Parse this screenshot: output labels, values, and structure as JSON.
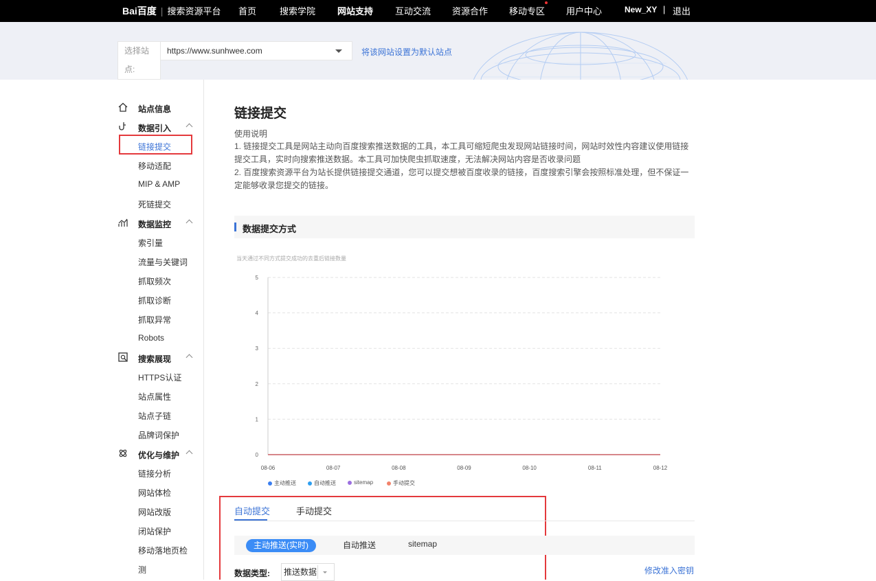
{
  "topnav": {
    "logo_text": "Bai百度",
    "platform": "搜索资源平台",
    "items": [
      "首页",
      "搜索学院",
      "网站支持",
      "互动交流",
      "资源合作",
      "移动专区",
      "用户中心"
    ],
    "active_item": "网站支持",
    "username": "New_XY",
    "separator": "|",
    "logout": "退出"
  },
  "site_selector": {
    "label": "选择站点:",
    "label_line1": "选择站",
    "label_line2": "点:",
    "value": "https://www.sunhwee.com",
    "set_default": "将该网站设置为默认站点"
  },
  "sidebar": {
    "sections": [
      {
        "label": "站点信息",
        "icon": "home-icon",
        "items": []
      },
      {
        "label": "数据引入",
        "icon": "data-import-icon",
        "items": [
          "链接提交",
          "移动适配",
          "MIP & AMP",
          "死链提交"
        ]
      },
      {
        "label": "数据监控",
        "icon": "monitor-icon",
        "items": [
          "索引量",
          "流量与关键词",
          "抓取频次",
          "抓取诊断",
          "抓取异常",
          "Robots"
        ]
      },
      {
        "label": "搜索展现",
        "icon": "search-display-icon",
        "items": [
          "HTTPS认证",
          "站点属性",
          "站点子链",
          "品牌词保护"
        ]
      },
      {
        "label": "优化与维护",
        "icon": "optimize-icon",
        "items": [
          "链接分析",
          "网站体检",
          "网站改版",
          "闭站保护",
          "移动落地页检",
          "测"
        ]
      }
    ],
    "active_item": "链接提交"
  },
  "main": {
    "title": "链接提交",
    "usage_title": "使用说明",
    "usage_paragraphs": [
      [
        "1. 链接提交工具是网站主动向百度搜索推送数据的工具，本工具可缩短爬虫发现网站链接时间，网站时效性内容建议使用链接",
        "提交工具，实时向搜索推送数据。本工具可加快爬虫抓取速度，无法解决网站内容是否收录问题"
      ],
      [
        "2. 百度搜索资源平台为站长提供链接提交通道，您可以提交想被百度收录的链接，百度搜索引擎会按照标准处理，但不保证一",
        "定能够收录您提交的链接。"
      ]
    ],
    "section_title": "数据提交方式",
    "chart_subtitle": "当天通过不同方式提交成功的去重后链接数量",
    "tabs": [
      "自动提交",
      "手动提交"
    ],
    "active_tab": "自动提交",
    "subtabs": [
      "主动推送(实时)",
      "自动推送",
      "sitemap"
    ],
    "active_subtab": "主动推送(实时)",
    "data_type_label": "数据类型:",
    "data_type_value": "推送数据",
    "modify_key": "修改准入密钥"
  },
  "chart_data": {
    "type": "line",
    "x": [
      "08-06",
      "08-07",
      "08-08",
      "08-09",
      "08-10",
      "08-11",
      "08-12"
    ],
    "ylim": [
      0,
      5
    ],
    "yticks": [
      0,
      1,
      2,
      3,
      4,
      5
    ],
    "grid": true,
    "legend_position": "bottom",
    "series": [
      {
        "name": "主动推送",
        "color": "#3b7ff0",
        "values": [
          0,
          0,
          0,
          0,
          0,
          0,
          0
        ]
      },
      {
        "name": "自动推送",
        "color": "#2f9ff0",
        "values": [
          0,
          0,
          0,
          0,
          0,
          0,
          0
        ]
      },
      {
        "name": "sitemap",
        "color": "#9b6fe0",
        "values": [
          0,
          0,
          0,
          0,
          0,
          0,
          0
        ]
      },
      {
        "name": "手动提交",
        "color": "#f2836b",
        "values": [
          0,
          0,
          0,
          0,
          0,
          0,
          0
        ]
      }
    ]
  }
}
